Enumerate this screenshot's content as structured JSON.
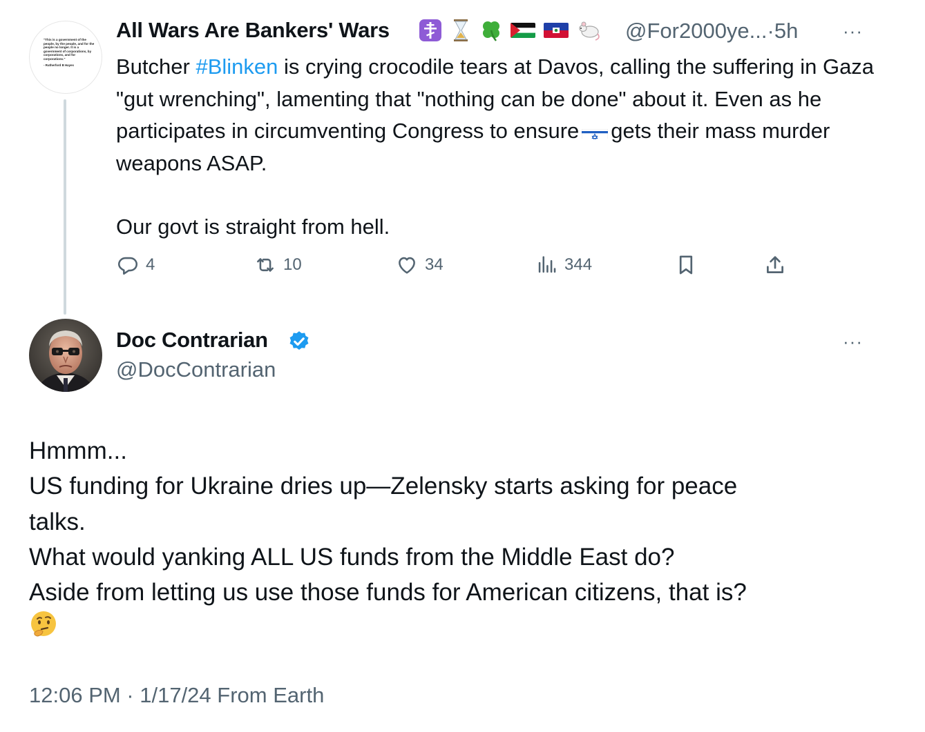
{
  "tweet1": {
    "avatar_quote": "\"This is a government of the people, by the people, and for the people no longer. It is a government of corporations, by corporations, and for corporations.\"",
    "avatar_author": "- Rutherford B Hayes",
    "display_name": "All Wars Are Bankers' Wars",
    "name_emojis": [
      "orthodox-cross-icon",
      "hourglass-icon",
      "four-leaf-clover-icon",
      "palestine-flag-icon",
      "haiti-flag-icon",
      "rat-icon"
    ],
    "handle": "@For2000ye...",
    "separator": "·",
    "time": "5h",
    "more": "···",
    "text_before_hashtag": "Butcher ",
    "hashtag": "#Blinken",
    "text_after_hashtag": " is crying crocodile tears at Davos, calling the suffering in Gaza \"gut wrenching\", lamenting that \"nothing can be done\" about it. Even as he participates in circumventing Congress to ensure",
    "text_after_flag": "gets their mass murder weapons ASAP.",
    "inline_flag": "israel-flag-icon",
    "paragraph2": "Our govt is straight from hell.",
    "stats": {
      "replies": "4",
      "reposts": "10",
      "likes": "34",
      "views": "344"
    }
  },
  "tweet2": {
    "display_name": "Doc Contrarian",
    "handle": "@DocContrarian",
    "more": "···",
    "lines": [
      "Hmmm...",
      "US funding for Ukraine dries up—Zelensky starts asking for peace",
      "talks.",
      "What would yanking ALL US funds from the Middle East do?",
      "Aside from letting us use those funds for American citizens, that is?"
    ],
    "end_emoji": "thinking-face-icon",
    "timestamp": "12:06 PM · 1/17/24 From Earth"
  },
  "colors": {
    "text": "#0f1419",
    "secondary": "#536471",
    "link": "#1d9bf0",
    "thread_line": "#cfd9de"
  }
}
